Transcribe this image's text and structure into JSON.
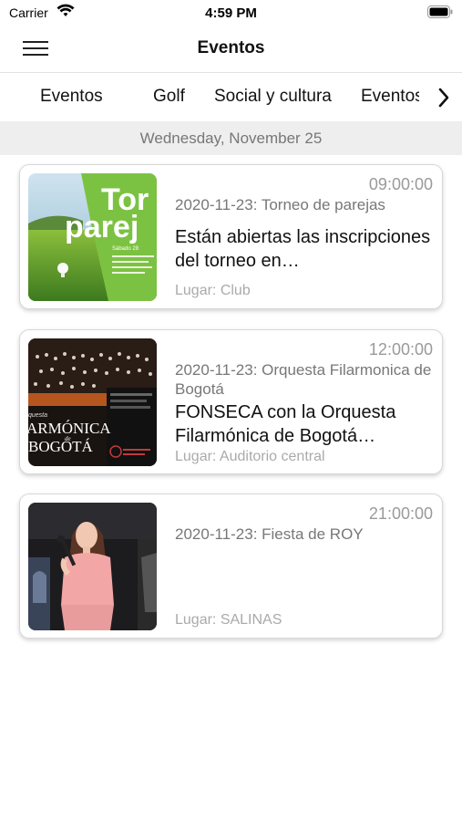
{
  "status_bar": {
    "carrier": "Carrier",
    "time": "4:59 PM"
  },
  "nav": {
    "title": "Eventos",
    "menu_icon": "hamburger-menu-icon"
  },
  "tabs": [
    {
      "label": "Eventos"
    },
    {
      "label": "Golf"
    },
    {
      "label": "Social y cultura"
    },
    {
      "label": "Eventos"
    }
  ],
  "tabs_next_icon": "chevron-right-icon",
  "date_header": "Wednesday, November 25",
  "events": [
    {
      "time": "09:00:00",
      "subtitle": "2020-11-23: Torneo de parejas",
      "title": "Están abiertas las inscripciones del torneo en…",
      "location": "Lugar: Club",
      "thumb_text": "Torneo parejas",
      "thumb_caption": "Sábado 28"
    },
    {
      "time": "12:00:00",
      "subtitle": "2020-11-23: Orquesta Filarmonica de Bogotá",
      "title": "FONSECA con la Orquesta Filarmónica de Bogotá…",
      "location": "Lugar: Auditorio central",
      "thumb_text_1": "ARMÓNICA",
      "thumb_text_2": "BOGOTÁ",
      "thumb_prefix": "questa",
      "thumb_de": "de"
    },
    {
      "time": "21:00:00",
      "subtitle": "2020-11-23: Fiesta de ROY",
      "title": "",
      "location": "Lugar: SALINAS"
    }
  ]
}
